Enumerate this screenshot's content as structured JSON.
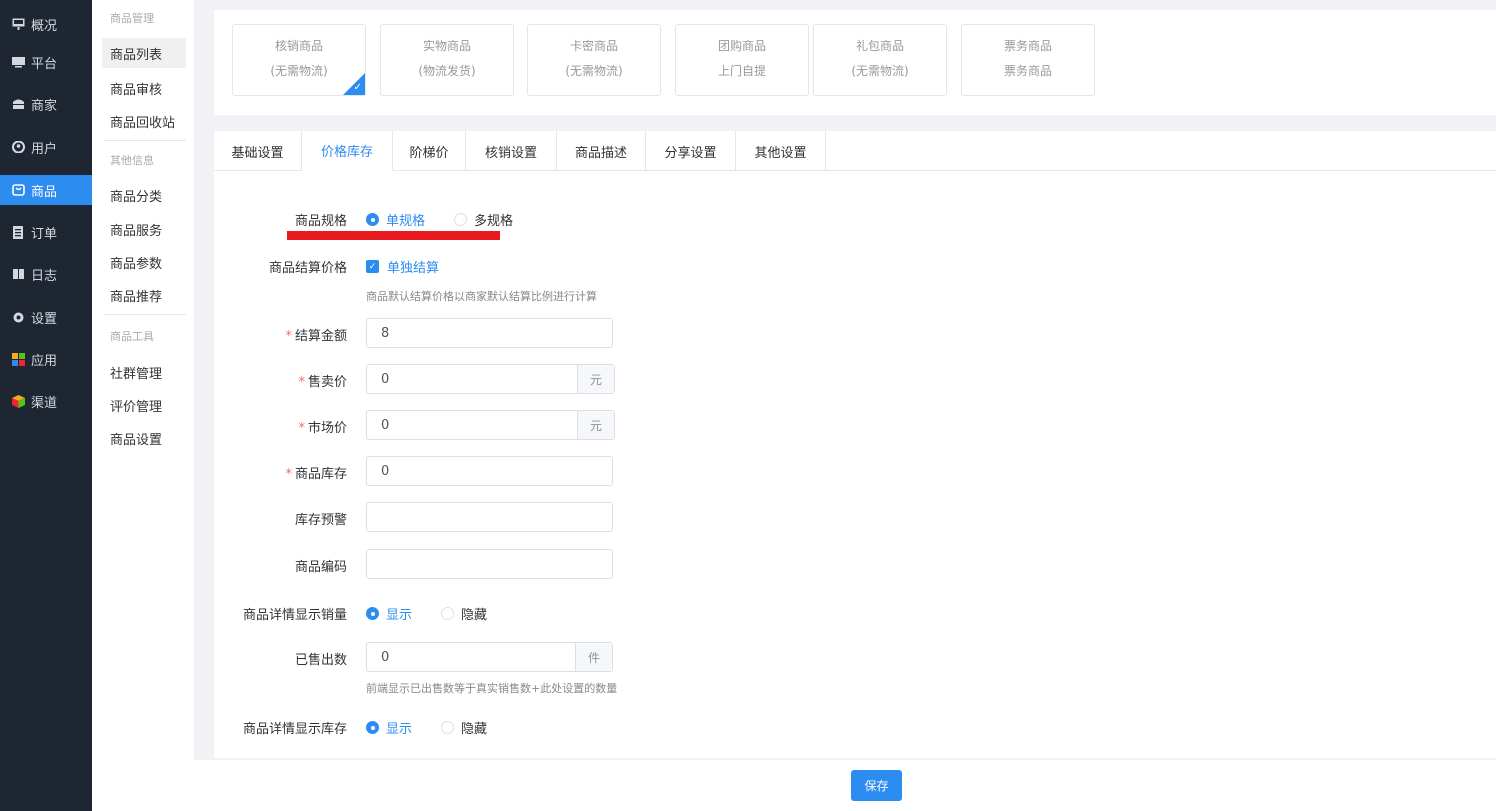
{
  "nav": {
    "items": [
      {
        "label": "概况",
        "icon": "presentation-icon"
      },
      {
        "label": "平台",
        "icon": "monitor-icon"
      },
      {
        "label": "商家",
        "icon": "store-icon"
      },
      {
        "label": "用户",
        "icon": "user-icon"
      },
      {
        "label": "商品",
        "icon": "shopping-bag-icon",
        "active": true
      },
      {
        "label": "订单",
        "icon": "order-icon"
      },
      {
        "label": "日志",
        "icon": "book-icon"
      },
      {
        "label": "设置",
        "icon": "gear-icon"
      },
      {
        "label": "应用",
        "icon": "apps-grid-icon"
      },
      {
        "label": "渠道",
        "icon": "cube-icon"
      }
    ]
  },
  "subnav": {
    "group1": "商品管理",
    "items1": [
      "商品列表",
      "商品审核",
      "商品回收站"
    ],
    "group2": "其他信息",
    "items2": [
      "商品分类",
      "商品服务",
      "商品参数",
      "商品推荐"
    ],
    "group3": "商品工具",
    "items3": [
      "社群管理",
      "评价管理",
      "商品设置"
    ]
  },
  "product_types": [
    {
      "name": "核销商品",
      "sub": "(无需物流)",
      "selected": true
    },
    {
      "name": "实物商品",
      "sub": "(物流发货)"
    },
    {
      "name": "卡密商品",
      "sub": "(无需物流)"
    },
    {
      "name": "团购商品",
      "sub": "上门自提"
    },
    {
      "name": "礼包商品",
      "sub": "(无需物流)"
    },
    {
      "name": "票务商品",
      "sub": "票务商品"
    }
  ],
  "tabs": [
    "基础设置",
    "价格库存",
    "阶梯价",
    "核销设置",
    "商品描述",
    "分享设置",
    "其他设置"
  ],
  "form": {
    "spec_label": "商品规格",
    "spec_single": "单规格",
    "spec_multi": "多规格",
    "settle_label": "商品结算价格",
    "settle_check": "单独结算",
    "settle_hint": "商品默认结算价格以商家默认结算比例进行计算",
    "settle_amount_label": "结算金额",
    "settle_amount_value": "8",
    "sale_price_label": "售卖价",
    "sale_price_value": "0",
    "market_price_label": "市场价",
    "market_price_value": "0",
    "currency_unit": "元",
    "stock_label": "商品库存",
    "stock_value": "0",
    "stock_warn_label": "库存预警",
    "stock_warn_value": "",
    "code_label": "商品编码",
    "code_value": "",
    "show_sales_label": "商品详情显示销量",
    "show_option": "显示",
    "hide_option": "隐藏",
    "sold_label": "已售出数",
    "sold_value": "0",
    "sold_unit": "件",
    "sold_hint": "前端显示已出售数等于真实销售数+此处设置的数量",
    "show_stock_label": "商品详情显示库存"
  },
  "save_label": "保存",
  "colors": {
    "accent": "#2d8cf0",
    "nav_bg": "#1d2631",
    "annotation": "#e8191f"
  }
}
